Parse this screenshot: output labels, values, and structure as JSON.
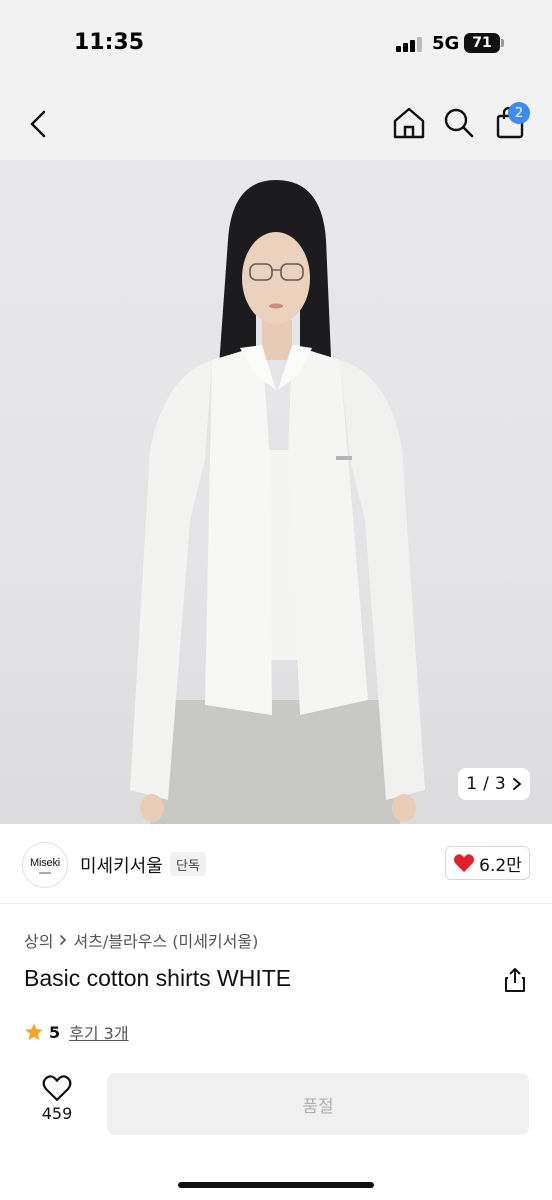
{
  "status_bar": {
    "time": "11:35",
    "network": "5G",
    "battery": "71"
  },
  "nav": {
    "back_icon": "chevron-left-icon",
    "home_icon": "home-icon",
    "search_icon": "search-icon",
    "cart_icon": "shopping-bag-icon",
    "cart_count": "2"
  },
  "gallery": {
    "counter_current": "1",
    "counter_sep": "/",
    "counter_total": "3",
    "counter_icon": "chevron-right-icon"
  },
  "brand": {
    "logo_text": "Miseki",
    "name": "미세키서울",
    "badge": "단독",
    "like_icon": "heart-filled-icon",
    "like_count": "6.2만",
    "like_color": "#e0202a"
  },
  "product": {
    "breadcrumb": [
      "상의",
      "셔츠/블라우스 (미세키서울)"
    ],
    "title": "Basic cotton shirts WHITE",
    "share_icon": "share-icon",
    "rating_icon": "star-icon",
    "rating_color": "#f5a623",
    "rating": "5",
    "review_link": "후기 3개"
  },
  "bottom_bar": {
    "wish_icon": "heart-outline-icon",
    "wish_count": "459",
    "buy_label": "품절"
  }
}
